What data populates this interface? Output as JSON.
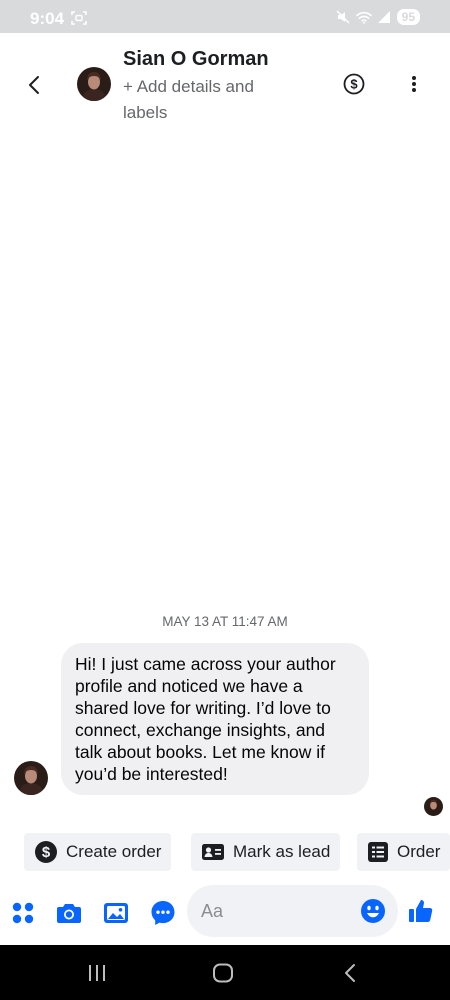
{
  "status_bar": {
    "time": "9:04",
    "battery": "95"
  },
  "header": {
    "contact_name": "Sian O Gorman",
    "subtitle": "+ Add details and labels"
  },
  "conversation": {
    "timestamp": "MAY 13 AT 11:47 AM",
    "messages": [
      {
        "sender": "Sian O Gorman",
        "text": "Hi! I just came across your author profile and noticed we have a shared love for writing. I’d love to connect, exchange insights, and talk about books. Let me know if you’d be interested!"
      }
    ]
  },
  "quick_actions": [
    {
      "label": "Create order",
      "icon": "dollar-circle-icon"
    },
    {
      "label": "Mark as lead",
      "icon": "contact-card-icon"
    },
    {
      "label": "Order",
      "icon": "list-document-icon"
    }
  ],
  "composer": {
    "placeholder": "Aa",
    "icons": [
      "apps-grid-icon",
      "camera-icon",
      "gallery-icon",
      "messenger-icon",
      "emoji-icon",
      "thumbs-up-icon"
    ]
  },
  "colors": {
    "accent": "#0866ff",
    "status_bar_bg": "#d9dadc",
    "bubble_bg": "#f0f0f2",
    "chip_bg": "#f0f2f5",
    "nav_bar_bg": "#000000"
  }
}
